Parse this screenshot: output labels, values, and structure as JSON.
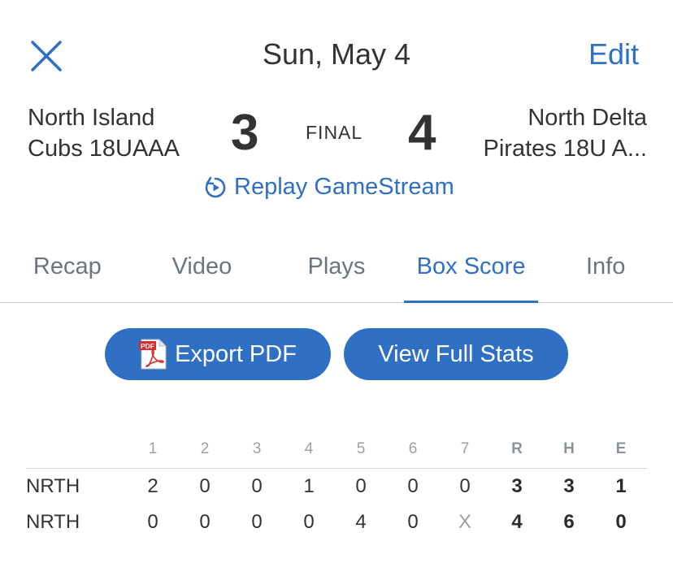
{
  "header": {
    "title": "Sun, May 4",
    "edit_label": "Edit"
  },
  "game": {
    "home_team": {
      "line1": "North Island",
      "line2": "Cubs 18UAAA",
      "score": "3"
    },
    "away_team": {
      "line1": "North Delta",
      "line2": "Pirates 18U A...",
      "score": "4"
    },
    "status": "FINAL",
    "replay_label": "Replay GameStream"
  },
  "tabs": [
    {
      "label": "Recap"
    },
    {
      "label": "Video"
    },
    {
      "label": "Plays"
    },
    {
      "label": "Box Score",
      "active": true
    },
    {
      "label": "Info"
    }
  ],
  "actions": {
    "export_pdf": "Export PDF",
    "view_full_stats": "View Full Stats"
  },
  "box_score": {
    "headers": [
      "1",
      "2",
      "3",
      "4",
      "5",
      "6",
      "7",
      "R",
      "H",
      "E"
    ],
    "rows": [
      {
        "team": "NRTH",
        "cells": [
          "2",
          "0",
          "0",
          "1",
          "0",
          "0",
          "0",
          "3",
          "3",
          "1"
        ]
      },
      {
        "team": "NRTH",
        "cells": [
          "0",
          "0",
          "0",
          "0",
          "4",
          "0",
          "X",
          "4",
          "6",
          "0"
        ]
      }
    ]
  },
  "colors": {
    "accent": "#2f6fc4",
    "text": "#333333",
    "muted": "#6b757e"
  }
}
